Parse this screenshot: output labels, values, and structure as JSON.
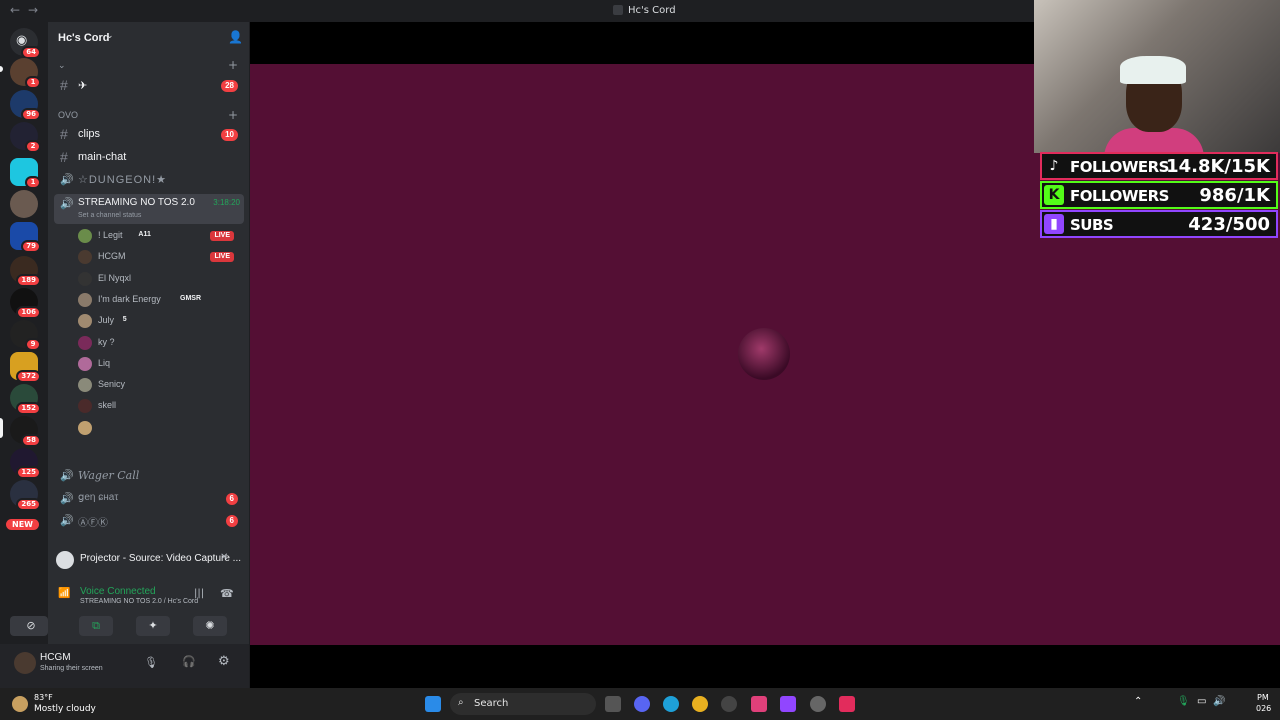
{
  "window": {
    "title": "Hc's Cord"
  },
  "server_rail": {
    "badges": [
      "64",
      "1",
      "96",
      "2",
      "1",
      "79",
      "189",
      "106",
      "9",
      "372",
      "152",
      "58",
      "125",
      "265"
    ],
    "new_label": "NEW"
  },
  "guild": {
    "name": "Hc's Cord"
  },
  "channels": {
    "top_channel": {
      "label": "✈",
      "count": "28"
    },
    "category_ovo": "OVO",
    "clips": {
      "label": "clips",
      "count": "10"
    },
    "main_chat": {
      "label": "main-chat"
    },
    "dungeon": {
      "label": "☆DUNGEON!★"
    },
    "streaming": {
      "label": "STREAMING NO TOS 2.0",
      "timer": "3:18:20",
      "status": "Set a channel status"
    },
    "wager": {
      "label": "Wager Call"
    },
    "gen_chat": {
      "label": "ցеη ɕнаτ",
      "count": "6"
    },
    "afk": {
      "label": "ⒶⒻⓀ",
      "count": "6"
    }
  },
  "voice_users": [
    {
      "name": "! Legit",
      "tag": "A11",
      "live": "LIVE",
      "color": "#6a8c4a"
    },
    {
      "name": "HCGM",
      "tag": "",
      "live": "LIVE",
      "color": "#4a3a30"
    },
    {
      "name": "El Nyqxl",
      "tag": "",
      "live": "",
      "color": "#333"
    },
    {
      "name": "I'm dark Energy",
      "tag": "GMSR",
      "live": "",
      "color": "#8a7a6a"
    },
    {
      "name": "July",
      "tag": "5",
      "live": "",
      "color": "#a08a70"
    },
    {
      "name": "ky ?",
      "tag": "",
      "live": "",
      "color": "#7a2a5a"
    },
    {
      "name": "Liq",
      "tag": "",
      "live": "",
      "color": "#b06a9a"
    },
    {
      "name": "Senicy",
      "tag": "",
      "live": "",
      "color": "#8a8a7a"
    },
    {
      "name": "skell",
      "tag": "",
      "live": "",
      "color": "#4a2a2a"
    },
    {
      "name": "",
      "tag": "",
      "live": "",
      "color": "#c0a070"
    }
  ],
  "projector": {
    "label": "Projector - Source: Video Capture ..."
  },
  "voice_panel": {
    "status": "Voice Connected",
    "location": "STREAMING NO TOS 2.0 / Hc's Cord"
  },
  "user_panel": {
    "name": "HCGM",
    "status": "Sharing their screen"
  },
  "overlay": {
    "tiktok": {
      "label": "FOLLOWERS",
      "value": "14.8K/15K",
      "color": "#e22c5c"
    },
    "kick": {
      "label": "FOLLOWERS",
      "value": "986/1K",
      "color": "#53fc18"
    },
    "twitch": {
      "label": "SUBS",
      "value": "423/500",
      "color": "#9146ff"
    }
  },
  "taskbar": {
    "weather_temp": "83°F",
    "weather_desc": "Mostly cloudy",
    "search_placeholder": "Search",
    "clock_time": "PM",
    "clock_date": "026"
  }
}
